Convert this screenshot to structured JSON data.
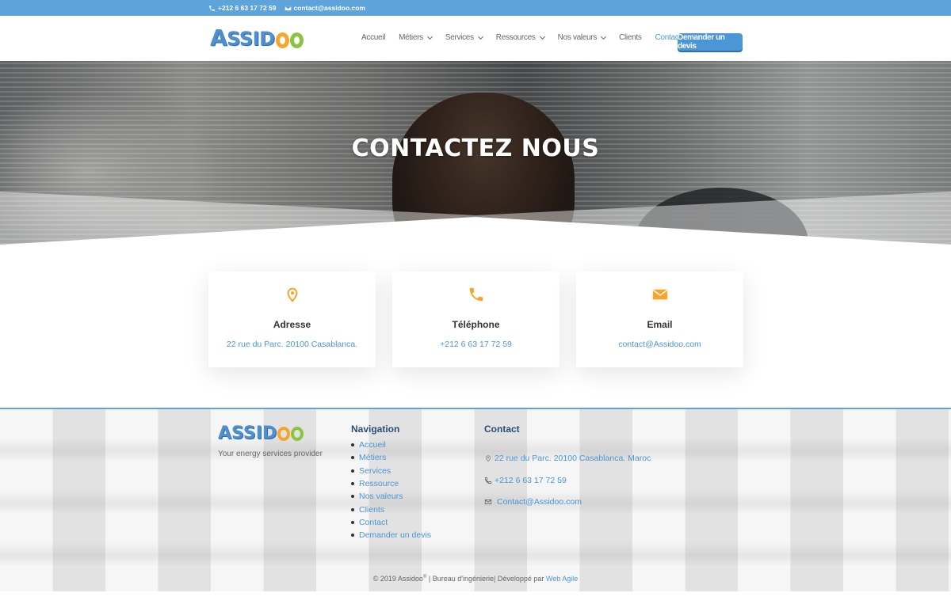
{
  "topbar": {
    "phone": "+212 6 63 17 72 59",
    "email": "contact@assidoo.com"
  },
  "logo": {
    "text_a": "A",
    "text_ssid": "SSID",
    "tagline": "Your energy services provider"
  },
  "nav": {
    "items": [
      {
        "label": "Accueil",
        "dropdown": false
      },
      {
        "label": "Métiers",
        "dropdown": true
      },
      {
        "label": "Services",
        "dropdown": true
      },
      {
        "label": "Ressources",
        "dropdown": true
      },
      {
        "label": "Nos valeurs",
        "dropdown": true
      },
      {
        "label": "Clients",
        "dropdown": false
      },
      {
        "label": "Contact",
        "dropdown": false,
        "active": true
      }
    ],
    "cta_label": "Demander un devis"
  },
  "hero": {
    "title": "CONTACTEZ NOUS"
  },
  "cards": [
    {
      "icon": "location-pin-icon",
      "title": "Adresse",
      "value": "22 rue du Parc. 20100 Casablanca."
    },
    {
      "icon": "phone-icon",
      "title": "Téléphone",
      "value": "+212 6 63 17 72 59"
    },
    {
      "icon": "envelope-icon",
      "title": "Email",
      "value": "contact@Assidoo.com"
    }
  ],
  "footer": {
    "nav_title": "Navigation",
    "nav_items": [
      "Accueil",
      "Métiers",
      "Services",
      "Ressource",
      "Nos valeurs",
      "Clients",
      "Contact",
      "Demander un devis"
    ],
    "contact_title": "Contact",
    "address": "22 rue du Parc. 20100 Casablanca. Maroc",
    "phone": "+212 6 63 17 72 59",
    "email": "Contact@Assidoo.com",
    "copyright_prefix": "© 2019 Assidoo",
    "copyright_mark": "®",
    "copyright_mid": " | Bureau d'ingénierie| Développé par ",
    "copyright_link": "Web Agile"
  },
  "colors": {
    "accent": "#4a96d6",
    "topbar": "#5fa3db",
    "orange": "#f7a52b",
    "green": "#8bc53f",
    "heading": "#2c4d7a"
  }
}
